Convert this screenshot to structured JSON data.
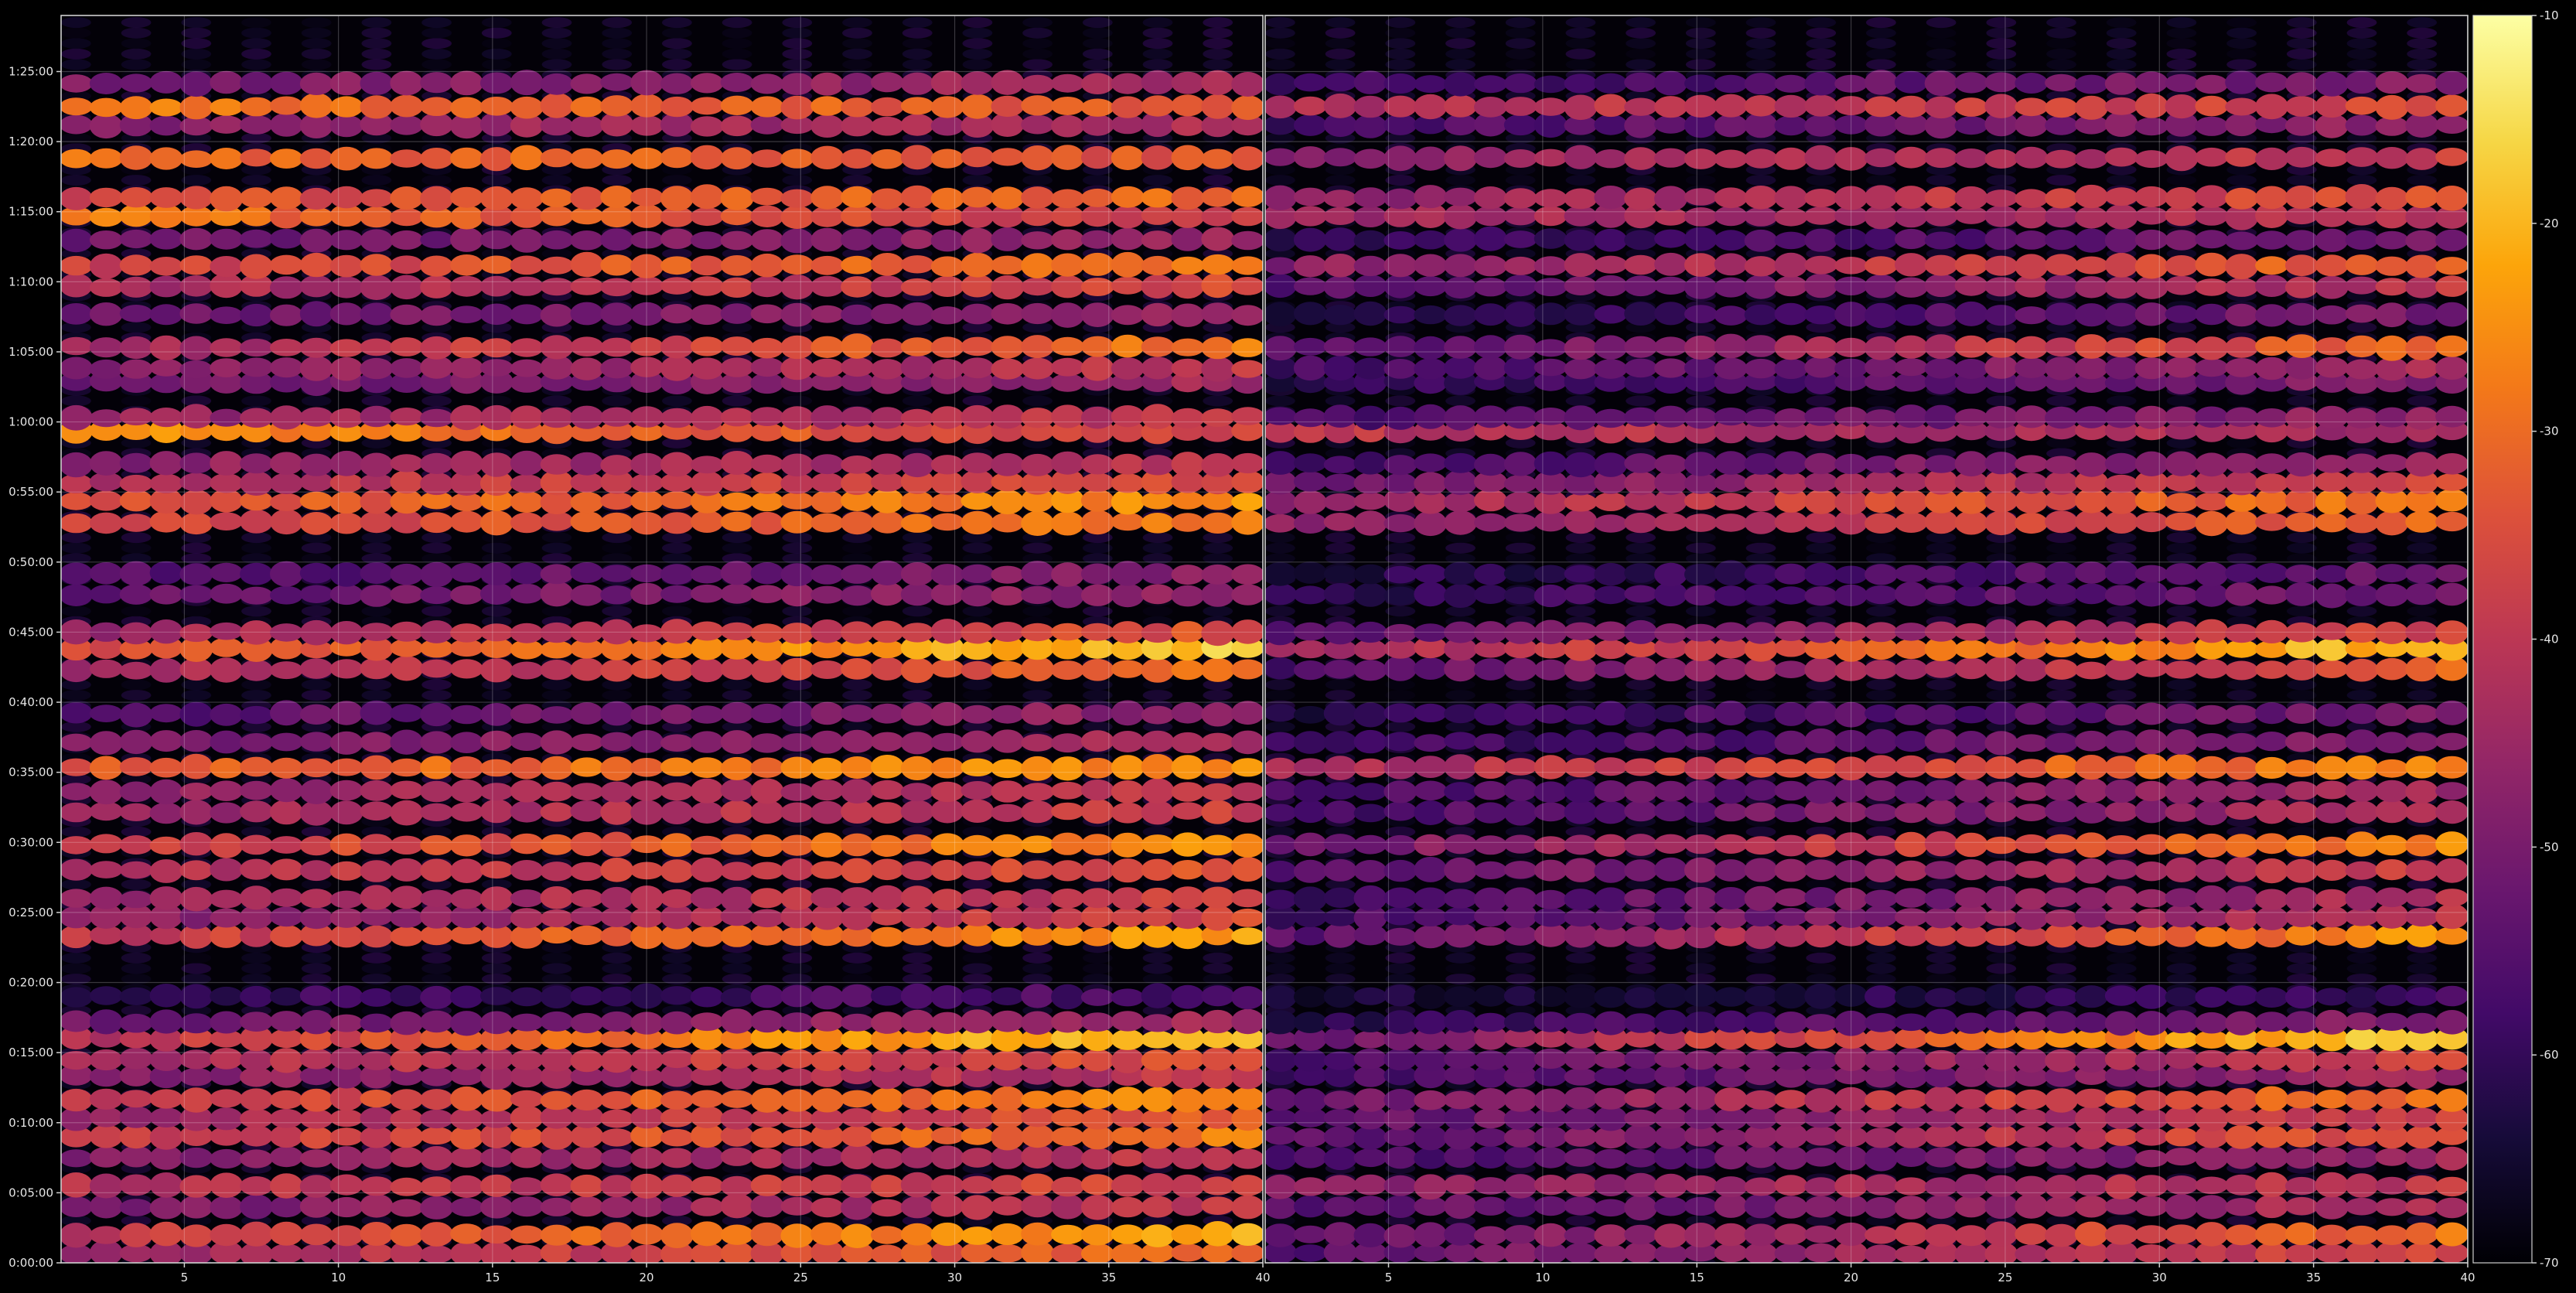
{
  "chart_data": {
    "type": "heatmap",
    "title": "",
    "xlabel": "",
    "ylabel": "",
    "grid": true,
    "panels": [
      {
        "name": "left",
        "x_range": [
          1,
          40
        ],
        "x_tick_labels": [
          "5",
          "10",
          "15",
          "20",
          "25",
          "30",
          "35",
          "40"
        ],
        "x_ticks": [
          5,
          10,
          15,
          20,
          25,
          30,
          35,
          40
        ]
      },
      {
        "name": "right",
        "x_range": [
          1,
          40
        ],
        "x_tick_labels": [
          "5",
          "10",
          "15",
          "20",
          "25",
          "30",
          "35",
          "40"
        ],
        "x_ticks": [
          5,
          10,
          15,
          20,
          25,
          30,
          35,
          40
        ]
      }
    ],
    "y_range_seconds": [
      0,
      5340
    ],
    "y_tick_labels": [
      "0:00:00",
      "0:05:00",
      "0:10:00",
      "0:15:00",
      "0:20:00",
      "0:25:00",
      "0:30:00",
      "0:35:00",
      "0:40:00",
      "0:45:00",
      "0:50:00",
      "0:55:00",
      "1:00:00",
      "1:05:00",
      "1:10:00",
      "1:15:00",
      "1:20:00",
      "1:25:00"
    ],
    "y_ticks_seconds": [
      0,
      300,
      600,
      900,
      1200,
      1500,
      1800,
      2100,
      2400,
      2700,
      3000,
      3300,
      3600,
      3900,
      4200,
      4500,
      4800,
      5100
    ],
    "colorbar": {
      "colormap": "inferno",
      "range": [
        -70,
        -10
      ],
      "tick_values": [
        -70,
        -60,
        -50,
        -40,
        -30,
        -20,
        -10
      ],
      "tick_labels": [
        "-70",
        "-60",
        "-50",
        "-40",
        "-30",
        "-20",
        "-10"
      ]
    },
    "bands": [
      {
        "t": 40,
        "left": [
          -45,
          -30
        ],
        "right": [
          -55,
          -35
        ]
      },
      {
        "t": 120,
        "left": [
          -40,
          -22
        ],
        "right": [
          -55,
          -28
        ]
      },
      {
        "t": 240,
        "left": [
          -50,
          -40
        ],
        "right": [
          -55,
          -42
        ]
      },
      {
        "t": 330,
        "left": [
          -42,
          -36
        ],
        "right": [
          -48,
          -40
        ]
      },
      {
        "t": 450,
        "left": [
          -48,
          -40
        ],
        "right": [
          -58,
          -45
        ]
      },
      {
        "t": 540,
        "left": [
          -40,
          -28
        ],
        "right": [
          -55,
          -32
        ]
      },
      {
        "t": 620,
        "left": [
          -45,
          -33
        ],
        "right": [
          -55,
          -36
        ]
      },
      {
        "t": 700,
        "left": [
          -40,
          -25
        ],
        "right": [
          -52,
          -28
        ]
      },
      {
        "t": 800,
        "left": [
          -48,
          -40
        ],
        "right": [
          -58,
          -44
        ]
      },
      {
        "t": 870,
        "left": [
          -44,
          -34
        ],
        "right": [
          -56,
          -38
        ]
      },
      {
        "t": 960,
        "left": [
          -42,
          -15
        ],
        "right": [
          -52,
          -15
        ]
      },
      {
        "t": 1030,
        "left": [
          -52,
          -44
        ],
        "right": [
          -62,
          -48
        ]
      },
      {
        "t": 1140,
        "left": [
          -60,
          -56
        ],
        "right": [
          -65,
          -58
        ]
      },
      {
        "t": 1400,
        "left": [
          -40,
          -22
        ],
        "right": [
          -55,
          -24
        ]
      },
      {
        "t": 1480,
        "left": [
          -48,
          -36
        ],
        "right": [
          -58,
          -40
        ]
      },
      {
        "t": 1560,
        "left": [
          -46,
          -38
        ],
        "right": [
          -58,
          -42
        ]
      },
      {
        "t": 1680,
        "left": [
          -42,
          -34
        ],
        "right": [
          -55,
          -38
        ]
      },
      {
        "t": 1790,
        "left": [
          -40,
          -24
        ],
        "right": [
          -52,
          -26
        ]
      },
      {
        "t": 1930,
        "left": [
          -45,
          -38
        ],
        "right": [
          -58,
          -42
        ]
      },
      {
        "t": 2020,
        "left": [
          -46,
          -40
        ],
        "right": [
          -58,
          -44
        ]
      },
      {
        "t": 2120,
        "left": [
          -34,
          -24
        ],
        "right": [
          -44,
          -26
        ]
      },
      {
        "t": 2230,
        "left": [
          -50,
          -44
        ],
        "right": [
          -60,
          -48
        ]
      },
      {
        "t": 2350,
        "left": [
          -55,
          -46
        ],
        "right": [
          -62,
          -50
        ]
      },
      {
        "t": 2540,
        "left": [
          -45,
          -30
        ],
        "right": [
          -56,
          -32
        ]
      },
      {
        "t": 2630,
        "left": [
          -36,
          -18
        ],
        "right": [
          -46,
          -18
        ]
      },
      {
        "t": 2700,
        "left": [
          -45,
          -34
        ],
        "right": [
          -55,
          -36
        ]
      },
      {
        "t": 2860,
        "left": [
          -54,
          -46
        ],
        "right": [
          -62,
          -50
        ]
      },
      {
        "t": 2950,
        "left": [
          -56,
          -48
        ],
        "right": [
          -63,
          -52
        ]
      },
      {
        "t": 3170,
        "left": [
          -38,
          -28
        ],
        "right": [
          -48,
          -30
        ]
      },
      {
        "t": 3260,
        "left": [
          -35,
          -25
        ],
        "right": [
          -46,
          -28
        ]
      },
      {
        "t": 3340,
        "left": [
          -42,
          -34
        ],
        "right": [
          -52,
          -36
        ]
      },
      {
        "t": 3420,
        "left": [
          -48,
          -40
        ],
        "right": [
          -58,
          -44
        ]
      },
      {
        "t": 3560,
        "left": [
          -25,
          -38
        ],
        "right": [
          -40,
          -45
        ]
      },
      {
        "t": 3620,
        "left": [
          -46,
          -40
        ],
        "right": [
          -58,
          -46
        ]
      },
      {
        "t": 3770,
        "left": [
          -52,
          -44
        ],
        "right": [
          -62,
          -48
        ]
      },
      {
        "t": 3830,
        "left": [
          -48,
          -40
        ],
        "right": [
          -58,
          -44
        ]
      },
      {
        "t": 3920,
        "left": [
          -45,
          -28
        ],
        "right": [
          -56,
          -30
        ]
      },
      {
        "t": 4060,
        "left": [
          -52,
          -46
        ],
        "right": [
          -62,
          -50
        ]
      },
      {
        "t": 4180,
        "left": [
          -44,
          -36
        ],
        "right": [
          -56,
          -40
        ]
      },
      {
        "t": 4270,
        "left": [
          -38,
          -28
        ],
        "right": [
          -48,
          -30
        ]
      },
      {
        "t": 4380,
        "left": [
          -52,
          -46
        ],
        "right": [
          -62,
          -50
        ]
      },
      {
        "t": 4480,
        "left": [
          -28,
          -40
        ],
        "right": [
          -44,
          -42
        ]
      },
      {
        "t": 4560,
        "left": [
          -36,
          -30
        ],
        "right": [
          -48,
          -34
        ]
      },
      {
        "t": 4730,
        "left": [
          -30,
          -34
        ],
        "right": [
          -48,
          -38
        ]
      },
      {
        "t": 4870,
        "left": [
          -48,
          -42
        ],
        "right": [
          -58,
          -46
        ]
      },
      {
        "t": 4950,
        "left": [
          -28,
          -34
        ],
        "right": [
          -42,
          -36
        ]
      },
      {
        "t": 5050,
        "left": [
          -50,
          -44
        ],
        "right": [
          -60,
          -48
        ]
      }
    ]
  }
}
